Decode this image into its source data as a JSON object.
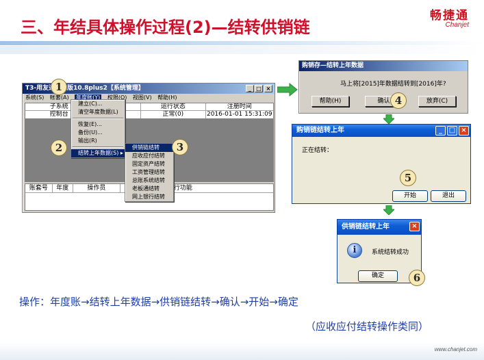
{
  "header": {
    "title": "三、年结具体操作过程(2)—结转供销链",
    "logo_cn": "畅捷通",
    "logo_en": "Chanjet"
  },
  "t3_window": {
    "title": "T3-用友通标准版10.8plus2【系统管理】",
    "menubar": [
      "系统(S)",
      "帐套(A)",
      "年度帐(Y)",
      "权限(O)",
      "视图(V)",
      "帮助(H)"
    ],
    "grid_headers": [
      "子系统",
      "",
      "运行状态",
      "注册时间"
    ],
    "grid_row": [
      "控制台",
      "",
      "正常(0)",
      "2016-01-01 15:31:09"
    ],
    "grid2_headers": [
      "账套号",
      "年度",
      "操作员",
      "",
      "执行功能"
    ],
    "year_menu": [
      "建立(C)...",
      "清空年度数据(L)",
      "恢复(E)...",
      "备份(U)...",
      "输出(R)",
      "结转上年数据(S)"
    ],
    "submenu": [
      "供销链结转",
      "应收应付结转",
      "固定资产结转",
      "工资管理结转",
      "总账系统结转",
      "老板通结转",
      "网上银行结转"
    ]
  },
  "dialog_confirm": {
    "title": "购销存—结转上年数据",
    "message": "马上将[2015]年数据结转到[2016]年?",
    "buttons": [
      "帮助(H)",
      "确认",
      "放弃(C)"
    ]
  },
  "dialog_progress": {
    "title": "购销链结转上年",
    "message": "正在结转：",
    "start_label": "开始",
    "exit_label": "退出"
  },
  "dialog_done": {
    "title": "供销链结转上年",
    "message": "系统结转成功",
    "ok_label": "确定"
  },
  "steps": [
    "1",
    "2",
    "3",
    "4",
    "5",
    "6"
  ],
  "instructions": {
    "line1": "操作：年度账→结转上年数据→供销链结转→确认→开始→确定",
    "line2": "（应收应付结转操作类同）"
  },
  "footer": {
    "url": "www.chanjet.com"
  },
  "colors": {
    "title_red": "#d0102a",
    "text_blue": "#1f3fa8",
    "arrow_green": "#3cb04a"
  }
}
